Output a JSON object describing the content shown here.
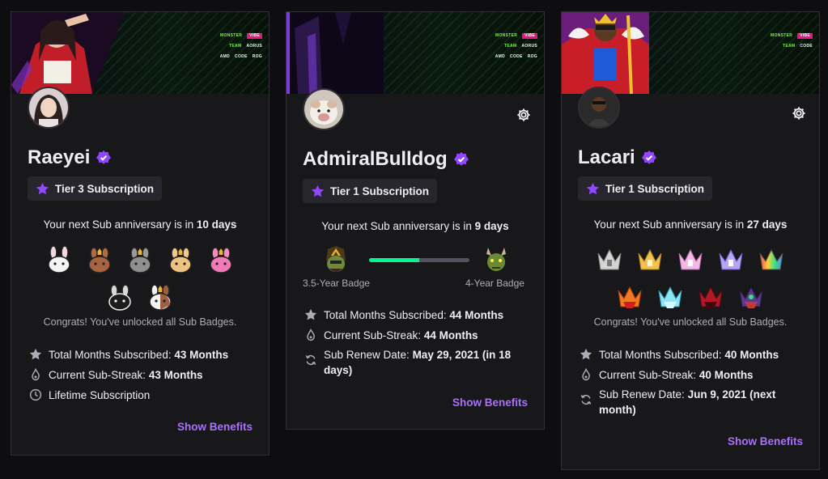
{
  "cards": [
    {
      "channel": "Raeyei",
      "tier": "Tier 3 Subscription",
      "anniversary_prefix": "Your next Sub anniversary is in ",
      "anniversary_value": "10 days",
      "congrats": "Congrats! You've unlocked all Sub Badges.",
      "stats": [
        {
          "icon": "star-icon",
          "label": "Total Months Subscribed: ",
          "value": "43 Months"
        },
        {
          "icon": "flame-icon",
          "label": "Current Sub-Streak: ",
          "value": "43 Months"
        },
        {
          "icon": "clock-icon",
          "label": "Lifetime Subscription",
          "value": ""
        }
      ],
      "show_benefits": "Show Benefits"
    },
    {
      "channel": "AdmiralBulldog",
      "tier": "Tier 1 Subscription",
      "anniversary_prefix": "Your next Sub anniversary is in ",
      "anniversary_value": "9 days",
      "badge_progress": {
        "current_label": "3.5-Year Badge",
        "next_label": "4-Year Badge",
        "progress": 0.5
      },
      "stats": [
        {
          "icon": "star-icon",
          "label": "Total Months Subscribed: ",
          "value": "44 Months"
        },
        {
          "icon": "flame-icon",
          "label": "Current Sub-Streak: ",
          "value": "44 Months"
        },
        {
          "icon": "renew-icon",
          "label": "Sub Renew Date: ",
          "value": "May 29, 2021 (in 18 days)"
        }
      ],
      "show_benefits": "Show Benefits"
    },
    {
      "channel": "Lacari",
      "tier": "Tier 1 Subscription",
      "anniversary_prefix": "Your next Sub anniversary is in ",
      "anniversary_value": "27 days",
      "congrats": "Congrats! You've unlocked all Sub Badges.",
      "stats": [
        {
          "icon": "star-icon",
          "label": "Total Months Subscribed: ",
          "value": "40 Months"
        },
        {
          "icon": "flame-icon",
          "label": "Current Sub-Streak: ",
          "value": "40 Months"
        },
        {
          "icon": "renew-icon",
          "label": "Sub Renew Date: ",
          "value": "Jun 9, 2021 (next month)"
        }
      ],
      "show_benefits": "Show Benefits"
    }
  ],
  "colors": {
    "accent": "#a970ff",
    "verified": "#9147ff",
    "progress": "#00f593",
    "background": "#0e0e10",
    "card": "#18181b"
  }
}
